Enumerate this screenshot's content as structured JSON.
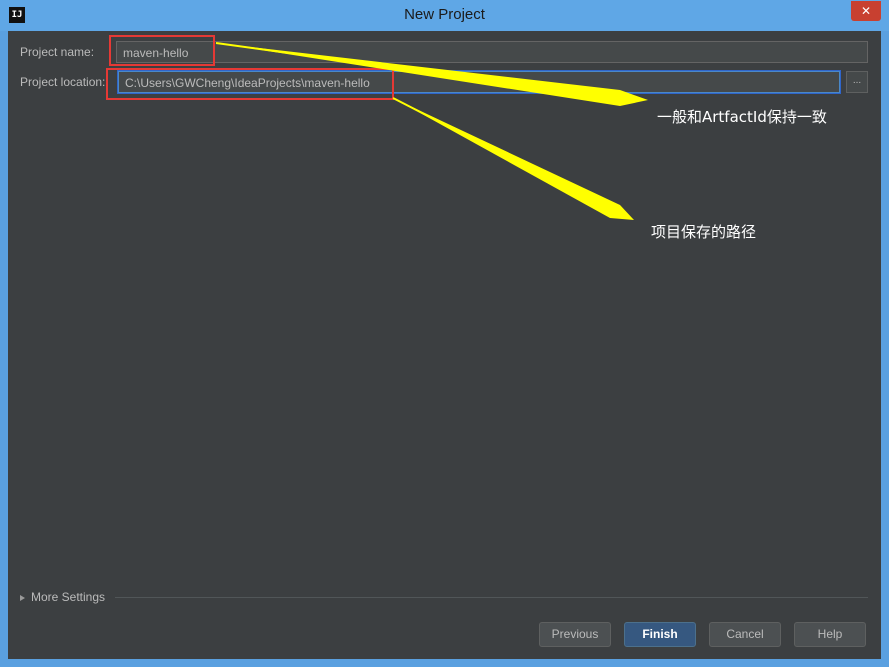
{
  "window": {
    "title": "New Project",
    "app_icon": "IJ"
  },
  "form": {
    "project_name_label": "Project name:",
    "project_name_value": "maven-hello",
    "project_location_label": "Project location:",
    "project_location_value": "C:\\Users\\GWCheng\\IdeaProjects\\maven-hello",
    "browse_label": "..."
  },
  "more_settings": "More Settings",
  "buttons": {
    "previous": "Previous",
    "finish": "Finish",
    "cancel": "Cancel",
    "help": "Help"
  },
  "annotations": {
    "name_note": "一般和ArtfactId保持一致",
    "location_note": "项目保存的路径"
  },
  "colors": {
    "annotation_arrow": "#ffff00",
    "highlight_box": "#e53935",
    "panel_bg": "#3c3f41"
  },
  "icons": {
    "close": "close-icon",
    "browse": "ellipsis-icon",
    "more_settings": "triangle-right-icon"
  }
}
